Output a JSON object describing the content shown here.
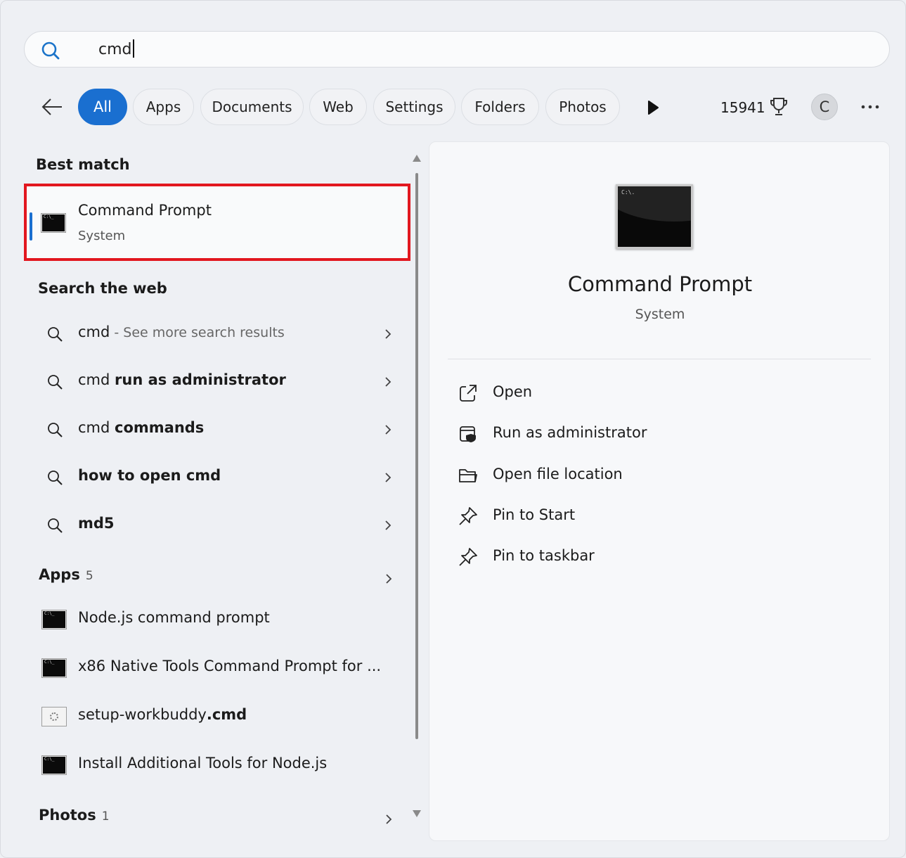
{
  "search": {
    "query": "cmd"
  },
  "filters": {
    "tabs": [
      {
        "label": "All",
        "active": true
      },
      {
        "label": "Apps"
      },
      {
        "label": "Documents"
      },
      {
        "label": "Web"
      },
      {
        "label": "Settings"
      },
      {
        "label": "Folders"
      },
      {
        "label": "Photos"
      }
    ],
    "points": "15941",
    "avatar_letter": "C"
  },
  "left": {
    "best_match": {
      "heading": "Best match",
      "title": "Command Prompt",
      "subtitle": "System",
      "icon": "cmd-icon"
    },
    "web": {
      "heading": "Search the web",
      "rows": [
        {
          "plain": "cmd",
          "bold": "",
          "muted": " - See more search results"
        },
        {
          "plain": "cmd ",
          "bold": "run as administrator",
          "muted": ""
        },
        {
          "plain": "cmd ",
          "bold": "commands",
          "muted": ""
        },
        {
          "plain": "",
          "bold": "how to open cmd",
          "muted": ""
        },
        {
          "plain": "",
          "bold": "md5",
          "muted": ""
        }
      ]
    },
    "apps": {
      "heading": "Apps",
      "count": "5",
      "rows": [
        {
          "plain": "Node.js command prompt",
          "bold": "",
          "icon": "cmd-icon"
        },
        {
          "plain": "x86 Native Tools Command Prompt for ...",
          "bold": "",
          "icon": "cmd-icon"
        },
        {
          "plain": "setup-workbuddy",
          "bold": ".cmd",
          "icon": "batch-file-icon"
        },
        {
          "plain": "Install Additional Tools for Node.js",
          "bold": "",
          "icon": "cmd-icon"
        }
      ]
    },
    "photos": {
      "heading": "Photos",
      "count": "1"
    }
  },
  "right": {
    "title": "Command Prompt",
    "subtitle": "System",
    "actions": [
      {
        "label": "Open",
        "icon": "open-external-icon"
      },
      {
        "label": "Run as administrator",
        "icon": "shield-admin-icon"
      },
      {
        "label": "Open file location",
        "icon": "folder-icon"
      },
      {
        "label": "Pin to Start",
        "icon": "pin-icon"
      },
      {
        "label": "Pin to taskbar",
        "icon": "pin-icon"
      }
    ]
  },
  "colors": {
    "accent": "#1a6fd0",
    "highlight_border": "#e2171f"
  }
}
